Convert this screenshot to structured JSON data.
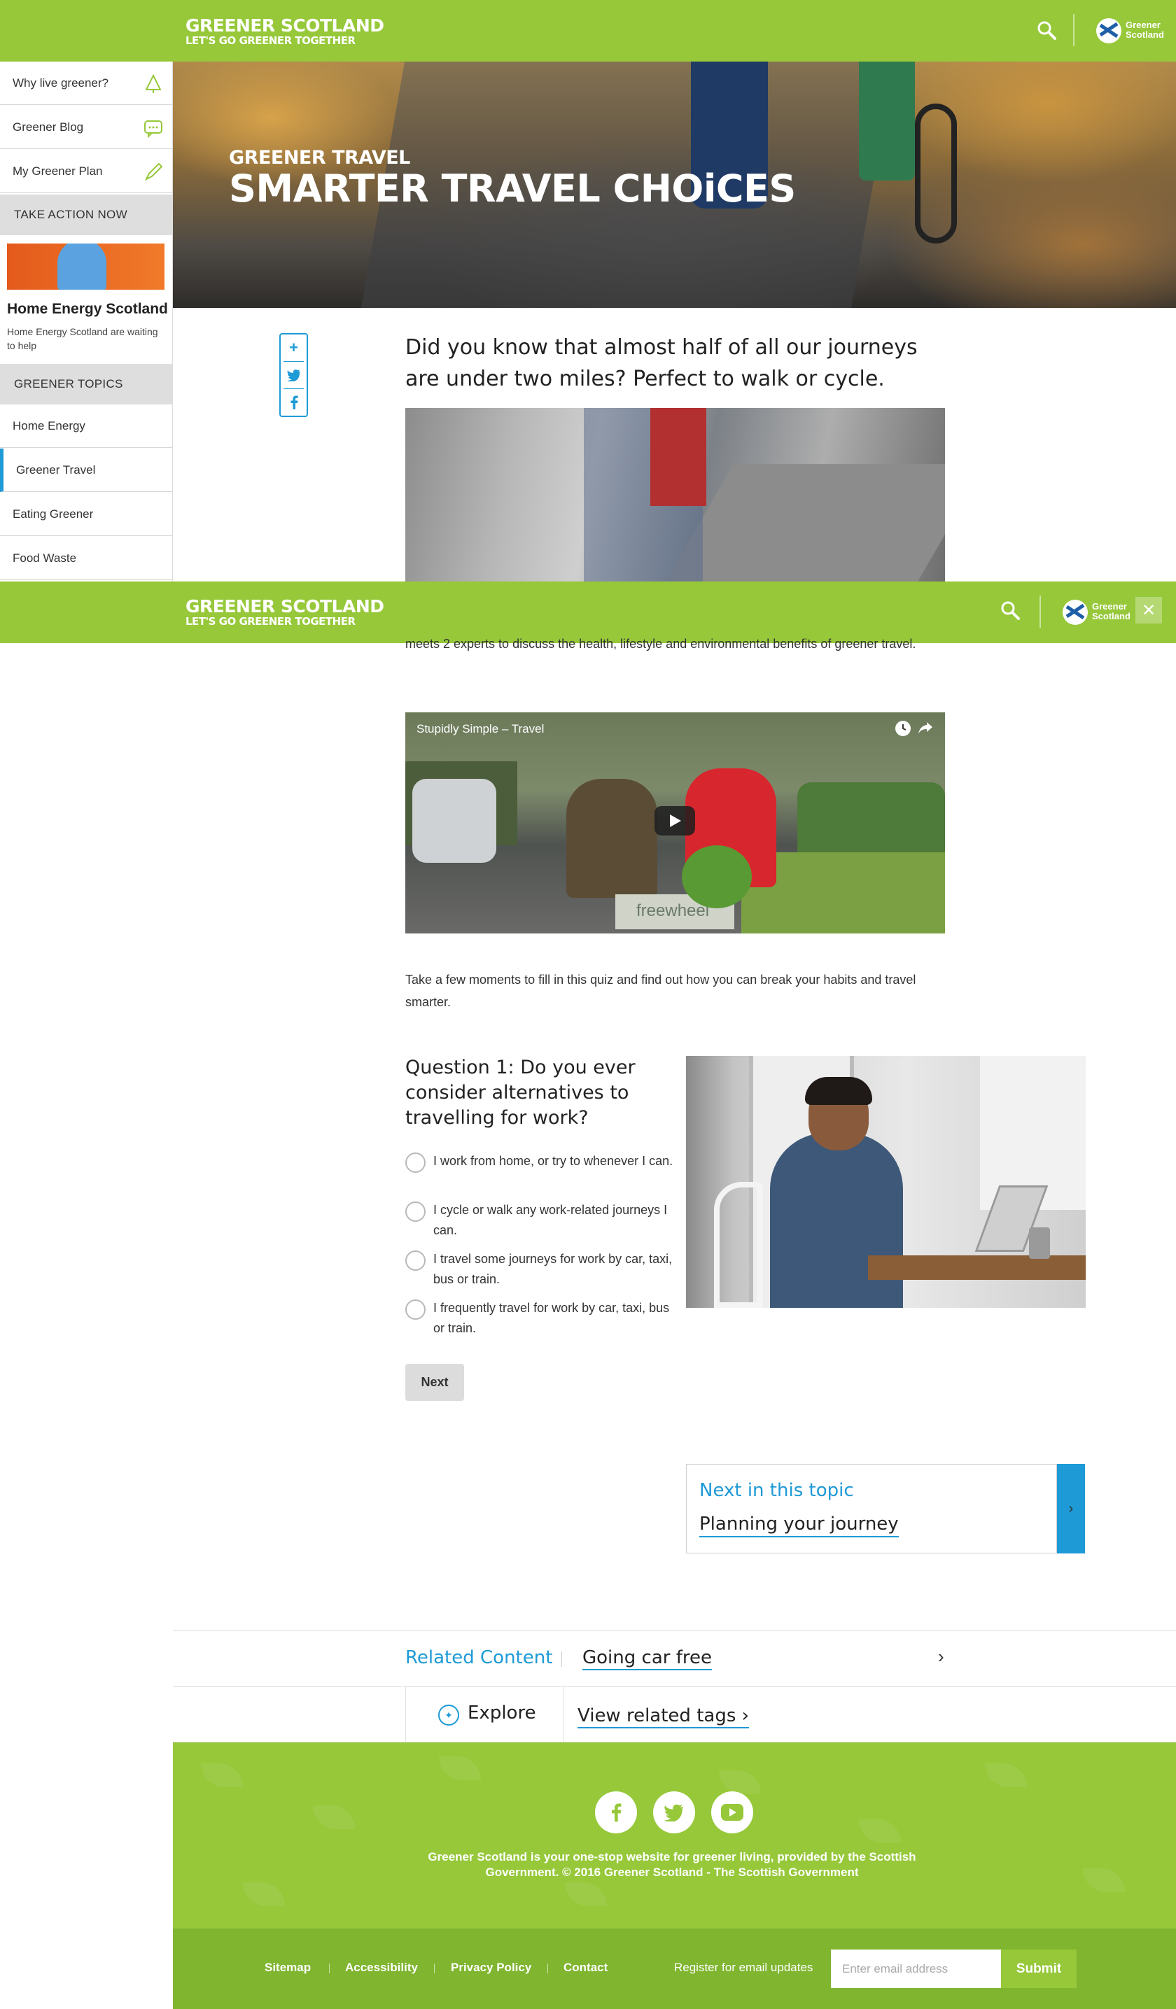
{
  "header": {
    "brand_title": "GREENER SCOTLAND",
    "brand_subtitle": "LET'S GO GREENER TOGETHER",
    "search_icon": "search-icon",
    "gov_logo_text": [
      "Greener",
      "Scotland"
    ]
  },
  "sidebar": {
    "items": [
      {
        "label": "Why live greener?",
        "icon": "tree-icon"
      },
      {
        "label": "Greener Blog",
        "icon": "chat-icon"
      },
      {
        "label": "My Greener Plan",
        "icon": "pencil-icon"
      }
    ],
    "take_action_heading": "TAKE ACTION NOW",
    "promo": {
      "title": "Home Energy Scotland",
      "text": "Home Energy Scotland are waiting to help"
    },
    "topics_heading": "GREENER TOPICS",
    "topics": [
      {
        "label": "Home Energy",
        "active": false
      },
      {
        "label": "Greener Travel",
        "active": true
      },
      {
        "label": "Eating Greener",
        "active": false
      },
      {
        "label": "Food Waste",
        "active": false
      }
    ]
  },
  "hero": {
    "kicker": "GREENER TRAVEL",
    "title": "SMARTER TRAVEL CHOiCES"
  },
  "share": {
    "buttons": [
      "plus-icon",
      "twitter-icon",
      "facebook-icon"
    ]
  },
  "intro": {
    "headline": "Did you know that almost half of all our journeys are under two miles? Perfect to walk or cycle.",
    "body": "meets 2 experts to discuss the health, lifestyle and environmental benefits of greener travel."
  },
  "sticky_header": {
    "brand_title": "GREENER SCOTLAND",
    "brand_subtitle": "LET'S GO GREENER TOGETHER",
    "close_label": "✕"
  },
  "video": {
    "title": "Stupidly Simple – Travel",
    "box_text": "freewheel"
  },
  "quiz": {
    "intro": "Take a few moments to fill in this quiz and find out how you can break your habits and travel smarter.",
    "question": "Question 1: Do you ever consider alternatives to travelling for work?",
    "options": [
      "I work from home, or try to whenever I can.",
      "I cycle or walk any work-related journeys I can.",
      "I travel some journeys for work by car, taxi, bus or train.",
      "I frequently travel for work by car, taxi, bus or train."
    ],
    "next_label": "Next"
  },
  "next_topic": {
    "label": "Next in this topic",
    "link": "Planning your journey",
    "arrow": "›"
  },
  "related": {
    "label": "Related Content",
    "link": "Going car free",
    "chevron": "›",
    "explore_label": "Explore",
    "tags_link": "View related tags ›"
  },
  "footer": {
    "social": [
      "facebook-icon",
      "twitter-icon",
      "youtube-icon"
    ],
    "text": "Greener Scotland is your one-stop website for greener living, provided by the Scottish Government. © 2016 Greener Scotland - The Scottish Government",
    "links": [
      "Sitemap",
      "Accessibility",
      "Privacy Policy",
      "Contact"
    ],
    "register_label": "Register for email updates",
    "email_placeholder": "Enter email address",
    "submit_label": "Submit"
  },
  "colors": {
    "brand_green": "#96c83a",
    "accent_blue": "#1e9ad6",
    "footer_dark_green": "#7fb52f"
  }
}
